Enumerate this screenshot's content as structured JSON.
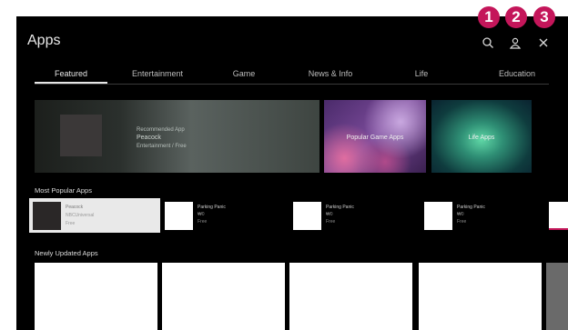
{
  "title": "Apps",
  "header_icons": [
    "search-icon",
    "user-icon",
    "close-icon"
  ],
  "callouts": [
    "1",
    "2",
    "3"
  ],
  "tabs": [
    "Featured",
    "Entertainment",
    "Game",
    "News & Info",
    "Life",
    "Education"
  ],
  "banners": {
    "main": {
      "line1": "Recommended App",
      "line2": "Peacock",
      "line3": "Entertainment / Free"
    },
    "game": "Popular Game Apps",
    "life": "Life Apps"
  },
  "sections": {
    "popular": "Most Popular Apps",
    "updated": "Newly Updated Apps"
  },
  "popular_apps": [
    {
      "name": "Peacock",
      "sub1": "NBCUniversal",
      "sub2": "Free"
    },
    {
      "name": "Parking Panic",
      "sub1": "₩0",
      "sub2": "Free"
    },
    {
      "name": "Parking Panic",
      "sub1": "₩0",
      "sub2": "Free"
    },
    {
      "name": "Parking Panic",
      "sub1": "₩0",
      "sub2": "Free"
    }
  ],
  "colors": {
    "callout": "#c4165a",
    "background": "#000000",
    "tab_active": "#e6e6e6"
  }
}
